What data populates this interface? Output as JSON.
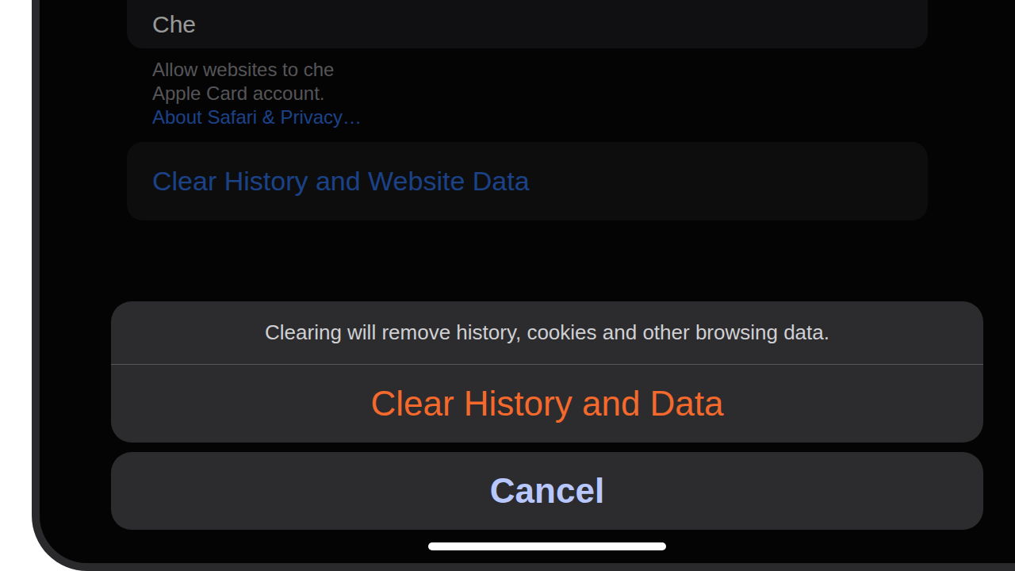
{
  "settings_row": {
    "label": "Che"
  },
  "footer": {
    "lines": [
      "Allow websites to che",
      "Apple Card account."
    ],
    "link": "About Safari & Privacy…"
  },
  "clear_row": {
    "label": "Clear History and Website Data"
  },
  "action_sheet": {
    "message": "Clearing will remove history, cookies and other browsing data.",
    "actions": [
      {
        "label": "Clear History and Data",
        "kind": "destructive"
      }
    ],
    "cancel": "Cancel"
  }
}
